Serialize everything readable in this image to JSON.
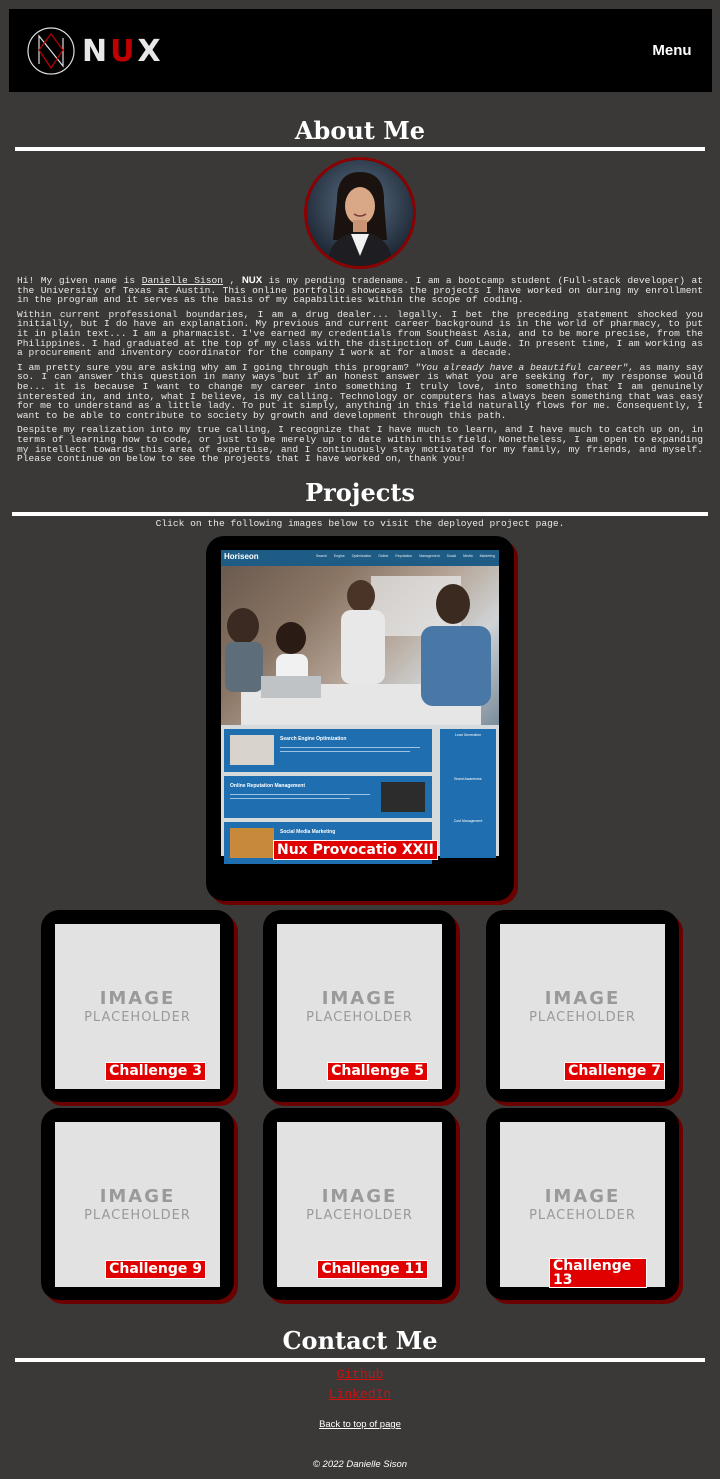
{
  "header": {
    "brand_prefix": "N",
    "brand_middle": "U",
    "brand_suffix": "X",
    "menu_label": "Menu",
    "logo_icon": "nux-monogram-icon"
  },
  "about": {
    "title": "About Me",
    "p1_a": "Hi! My given name is ",
    "p1_name": "Danielle Sison",
    "p1_b": " , ",
    "p1_brand": "NUX",
    "p1_c": " is my pending tradename. I am a bootcamp student (Full-stack developer) at the University of Texas at Austin. This online portfolio showcases the projects I have worked on during my enrollment in the program and it serves as the basis of my capabilities within the scope of coding.",
    "p2": "Within current professional boundaries, I am a drug dealer... legally. I bet the preceding statement shocked you initially, but I do have an explanation. My previous and current career background is in the world of pharmacy, to put it in plain text... I am a pharmacist. I've earned my credentials from Southeast Asia, and to be more precise, from the Philippines. I had graduated at the top of my class with the distinction of Cum Laude. In present time, I am working as a procurement and inventory coordinator for the company I work at for almost a decade.",
    "p3_a": "I am pretty sure you are asking why am I going through this program? ",
    "p3_quote": "\"You already have a beautiful career\"",
    "p3_b": ", as many say so. I can answer this question in many ways but if an honest answer is what you are seeking for, my response would be... it is because I want to change my career into something I truly love, into something that I am genuinely interested in, and into, what I believe, is my calling. Technology or computers has always been something that was easy for me to understand as a little lady. To put it simply, anything in this field naturally flows for me. Consequently, I want to be able to contribute to society by growth and development through this path.",
    "p4": "Despite my realization into my true calling, I recognize that I have much to learn, and I have much to catch up on, in terms of learning how to code, or just to be merely up to date within this field. Nonetheless, I am open to expanding my intellect towards this area of expertise, and I continuously stay motivated for my family, my friends, and myself. Please continue on below to see the projects that I have worked on, thank you!"
  },
  "projects": {
    "title": "Projects",
    "hint": "Click on the following images below to visit the deployed project page.",
    "featured": {
      "caption": "Nux Provocatio XXII",
      "site_title": "Horiseon",
      "site_nav": "Search Engine Optimization   Online Reputation Management   Social Media Marketing",
      "block_1": "Search Engine Optimization",
      "block_2": "Online Reputation Management",
      "block_3": "Social Media Marketing",
      "side_1": "Lead Generation",
      "side_2": "Brand Awareness",
      "side_3": "Cost Management"
    },
    "placeholder_big": "IMAGE",
    "placeholder_small": "PLACEHOLDER",
    "cards": [
      {
        "caption": "Challenge 3"
      },
      {
        "caption": "Challenge 5"
      },
      {
        "caption": "Challenge 7"
      },
      {
        "caption": "Challenge 9"
      },
      {
        "caption": "Challenge 11"
      },
      {
        "caption": "Challenge 13"
      }
    ]
  },
  "contact": {
    "title": "Contact Me",
    "github": "Github",
    "linkedin": "LinkedIn",
    "back_to_top": "Back to top of page"
  },
  "footer": {
    "copyright": "©  2022 Danielle Sison"
  },
  "colors": {
    "background": "#3a3938",
    "header": "#000000",
    "accent_red": "#e00000",
    "link_red": "#cc1111"
  }
}
